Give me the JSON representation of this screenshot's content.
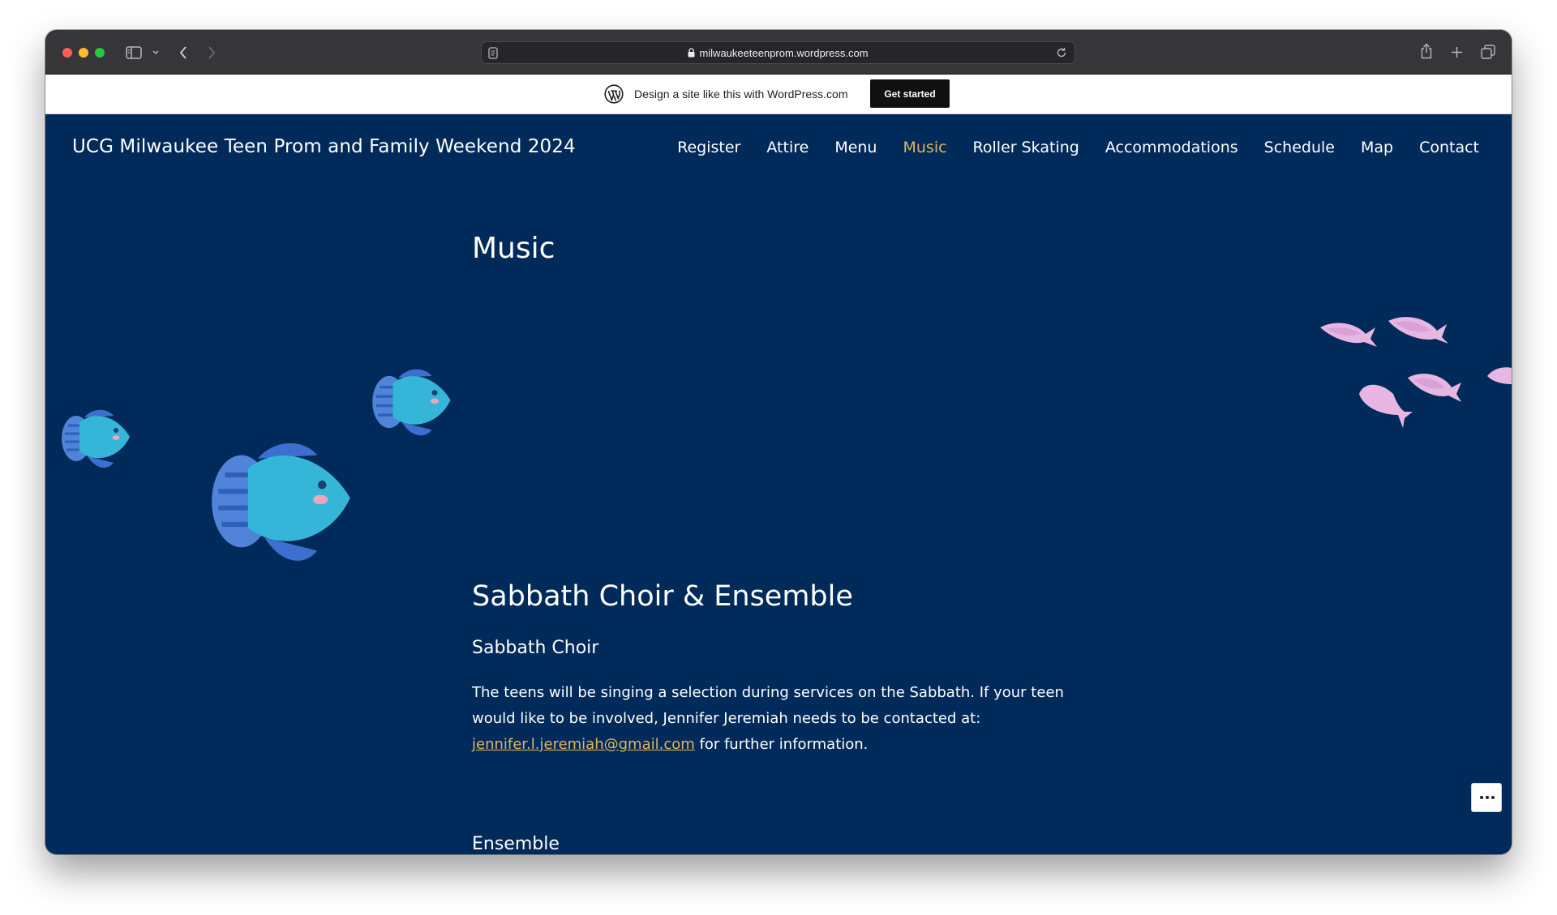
{
  "browser": {
    "url": "milwaukeeteenprom.wordpress.com"
  },
  "wp_banner": {
    "promo_text": "Design a site like this with WordPress.com",
    "cta_label": "Get started"
  },
  "site": {
    "title": "UCG Milwaukee Teen Prom and Family Weekend 2024",
    "nav": [
      {
        "label": "Register",
        "active": false
      },
      {
        "label": "Attire",
        "active": false
      },
      {
        "label": "Menu",
        "active": false
      },
      {
        "label": "Music",
        "active": true
      },
      {
        "label": "Roller Skating",
        "active": false
      },
      {
        "label": "Accommodations",
        "active": false
      },
      {
        "label": "Schedule",
        "active": false
      },
      {
        "label": "Map",
        "active": false
      },
      {
        "label": "Contact",
        "active": false
      }
    ]
  },
  "page": {
    "title": "Music",
    "section_heading": "Sabbath Choir & Ensemble",
    "choir_heading": "Sabbath Choir",
    "choir_text_before": "The teens will be singing a selection during services on the Sabbath. If your teen would like to be involved, Jennifer Jeremiah needs to be contacted at: ",
    "choir_email": "jennifer.l.jeremiah@gmail.com",
    "choir_text_after": " for further information.",
    "ensemble_heading": "Ensemble"
  },
  "colors": {
    "background": "#002a5a",
    "accent": "#e2b55b",
    "text": "#ffffff"
  },
  "icons": {
    "reader": "reader-icon",
    "sidebar": "sidebar-icon",
    "back": "chevron-left-icon",
    "forward": "chevron-right-icon",
    "lock": "lock-icon",
    "reload": "reload-icon",
    "share": "share-icon",
    "new_tab": "plus-icon",
    "tabs": "tabs-overview-icon",
    "wordpress": "wordpress-logo-icon",
    "more": "ellipsis-icon"
  }
}
